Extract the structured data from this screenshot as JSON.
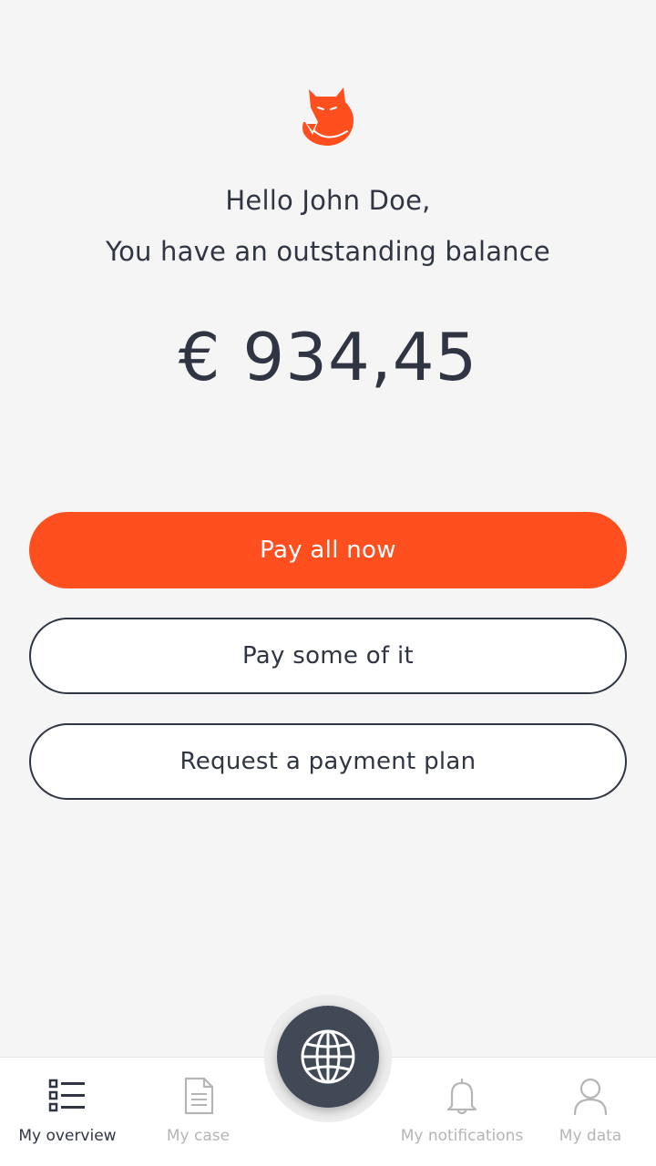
{
  "greeting": {
    "line1": "Hello John Doe,",
    "line2": "You have an outstanding balance"
  },
  "balance": "€ 934,45",
  "actions": {
    "pay_all": "Pay all now",
    "pay_some": "Pay some of it",
    "payment_plan": "Request a payment plan"
  },
  "nav": {
    "items": [
      {
        "label": "My overview",
        "icon": "list-icon",
        "active": true
      },
      {
        "label": "My case",
        "icon": "document-icon",
        "active": false
      },
      {
        "label": "My notifications",
        "icon": "bell-icon",
        "active": false
      },
      {
        "label": "My data",
        "icon": "user-icon",
        "active": false
      }
    ],
    "center_icon": "globe-icon"
  },
  "colors": {
    "accent": "#ff4f1f",
    "text": "#2f3542",
    "inactive": "#b5b5b5",
    "fab": "#414957",
    "background": "#f5f5f5"
  }
}
